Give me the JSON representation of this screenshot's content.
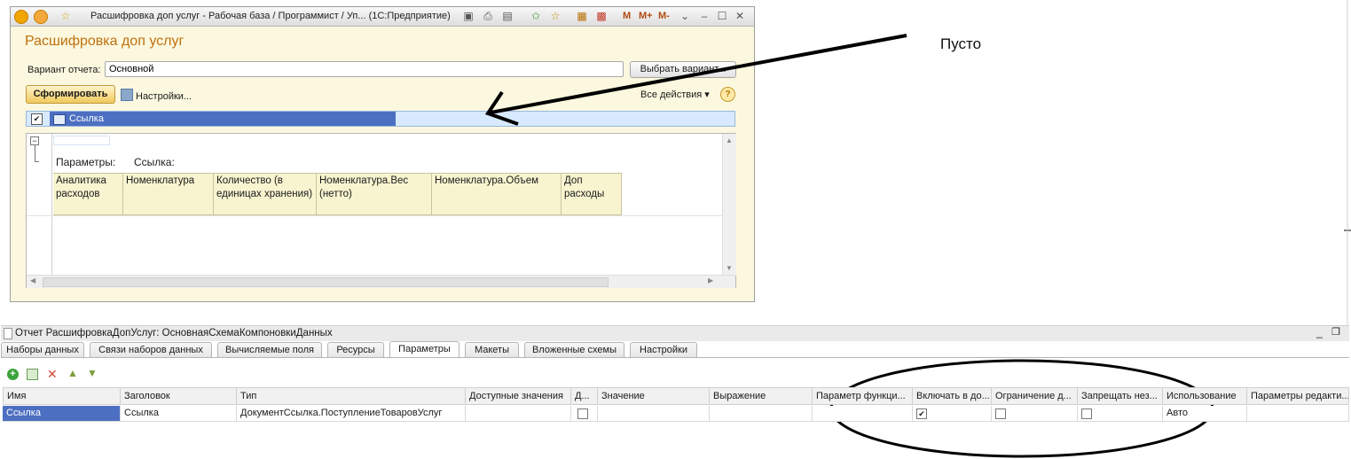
{
  "window": {
    "title": "Расшифровка доп услуг - Рабочая база / Программист / Уп...   (1С:Предприятие)",
    "toolbar_labels": {
      "m": "M",
      "mplus": "M+",
      "mminus": "M-"
    }
  },
  "report": {
    "heading": "Расшифровка доп услуг",
    "variant_label": "Вариант отчета:",
    "variant_value": "Основной",
    "choose_variant_label": "Выбрать вариант...",
    "generate_label": "Сформировать",
    "settings_label": "Настройки...",
    "all_actions_label": "Все действия ▾",
    "help_label": "?",
    "group_field_label": "Ссылка",
    "parameters_label": "Параметры:",
    "parameters_value": "Ссылка:",
    "table_headers": [
      "Аналитика расходов",
      "Номенклатура",
      "Количество (в единицах хранения)",
      "Номенклатура.Вес (нетто)",
      "Номенклатура.Объем",
      "Доп расходы"
    ]
  },
  "annotation": {
    "text": "Пусто"
  },
  "config": {
    "title": "Отчет РасшифровкаДопУслуг: ОсновнаяСхемаКомпоновкиДанных",
    "tabs": [
      "Наборы данных",
      "Связи наборов данных",
      "Вычисляемые поля",
      "Ресурсы",
      "Параметры",
      "Макеты",
      "Вложенные схемы",
      "Настройки"
    ],
    "active_tab": "Параметры",
    "columns": [
      "Имя",
      "Заголовок",
      "Тип",
      "Доступные значения",
      "Д...",
      "Значение",
      "Выражение",
      "Параметр функци...",
      "Включать в до...",
      "Ограничение д...",
      "Запрещать нез...",
      "Использование",
      "Параметры редакти..."
    ],
    "row": {
      "name": "Ссылка",
      "header": "Ссылка",
      "type": "ДокументСсылка.ПоступлениеТоваровУслуг",
      "include_checked": true,
      "restrict_checked": false,
      "forbid_checked": false,
      "usage": "Авто"
    }
  }
}
